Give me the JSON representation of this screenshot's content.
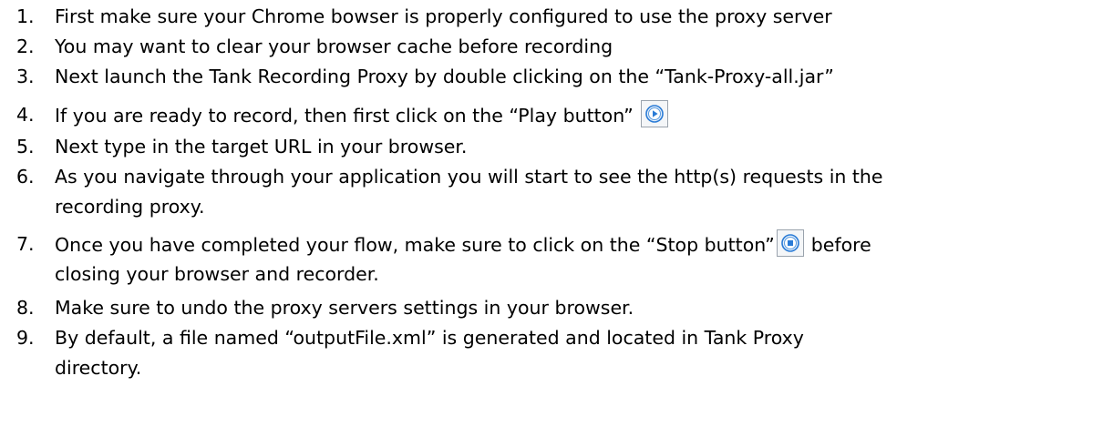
{
  "items": [
    {
      "num": "1.",
      "text": "First make sure your Chrome bowser is properly configured to use the proxy server"
    },
    {
      "num": "2.",
      "text": "You may want to clear your browser cache before recording"
    },
    {
      "num": "3.",
      "text": "Next launch the Tank Recording Proxy by double clicking on the “Tank-Proxy-all.jar”"
    },
    {
      "num": "4.",
      "text": "If you are ready to record, then first click on the “Play button”",
      "icon": "play-icon"
    },
    {
      "num": "5.",
      "text": "Next type in the target URL in your browser."
    },
    {
      "num": "6.",
      "text": "As you navigate through your application you will start to see the http(s) requests in the",
      "cont": "recording proxy."
    },
    {
      "num": "7.",
      "text": "Once you have completed your flow, make sure to click on the “Stop button”",
      "icon": "stop-icon",
      "text_after": "before",
      "cont": "closing your browser and recorder."
    },
    {
      "num": "8.",
      "text": "Make sure to undo the proxy servers settings in your browser."
    },
    {
      "num": "9.",
      "text": "By default, a file named “outputFile.xml” is generated and located in Tank Proxy",
      "cont": "directory."
    }
  ],
  "colors": {
    "text": "#000000",
    "icon_blue": "#2a7bd6",
    "icon_border": "#9aa3ad"
  }
}
